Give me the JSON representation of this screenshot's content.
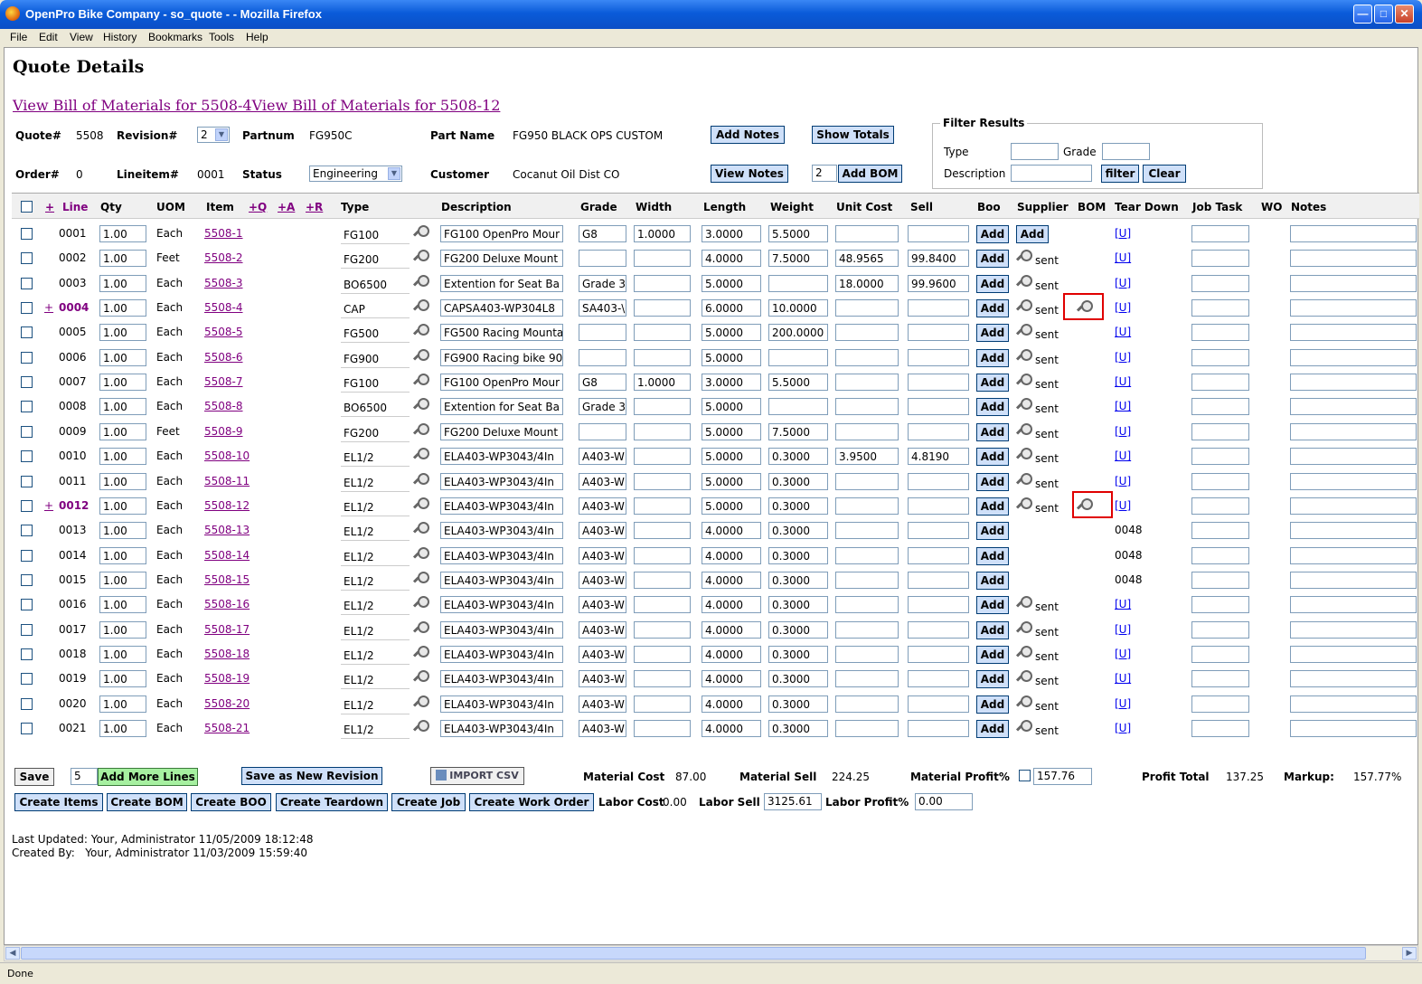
{
  "window": {
    "title": "OpenPro Bike Company - so_quote - - Mozilla Firefox"
  },
  "menu": [
    "File",
    "Edit",
    "View",
    "History",
    "Bookmarks",
    "Tools",
    "Help"
  ],
  "page": {
    "title": "Quote Details",
    "bom_links": "View Bill of Materials for 5508-4View Bill of Materials for 5508-12"
  },
  "header": {
    "quote_label": "Quote#",
    "quote": "5508",
    "revision_label": "Revision#",
    "revision": "2",
    "partnum_label": "Partnum",
    "partnum": "FG950C",
    "partname_label": "Part Name",
    "partname": "FG950 BLACK OPS CUSTOM",
    "order_label": "Order#",
    "order": "0",
    "lineitem_label": "Lineitem#",
    "lineitem": "0001",
    "status_label": "Status",
    "status": "Engineering",
    "customer_label": "Customer",
    "customer": "Cocanut Oil Dist CO",
    "add_notes": "Add Notes",
    "show_totals": "Show Totals",
    "view_notes": "View Notes",
    "bom_qty": "2",
    "add_bom": "Add BOM"
  },
  "filter": {
    "legend": "Filter Results",
    "type_label": "Type",
    "grade_label": "Grade",
    "description_label": "Description",
    "filter_btn": "filter",
    "clear_btn": "Clear"
  },
  "columns": {
    "plus": "+",
    "line": "Line",
    "qty": "Qty",
    "uom": "UOM",
    "item": "Item",
    "q": "+Q",
    "a": "+A",
    "r": "+R",
    "type": "Type",
    "description": "Description",
    "grade": "Grade",
    "width": "Width",
    "length": "Length",
    "weight": "Weight",
    "unit_cost": "Unit Cost",
    "sell": "Sell",
    "boo": "Boo",
    "supplier": "Supplier",
    "bom": "BOM",
    "tear_down": "Tear Down",
    "job_task": "Job Task",
    "wo": "WO",
    "notes": "Notes"
  },
  "rows": [
    {
      "plus": "",
      "line": "0001",
      "qty": "1.00",
      "uom": "Each",
      "item": "5508-1",
      "type": "FG100",
      "desc": "FG100 OpenPro Mour",
      "grade": "G8",
      "width": "1.0000",
      "length": "3.0000",
      "weight": "5.5000",
      "unit_cost": "",
      "sell": "",
      "supplier": "add",
      "bom": false,
      "tear": "[U]"
    },
    {
      "plus": "",
      "line": "0002",
      "qty": "1.00",
      "uom": "Feet",
      "item": "5508-2",
      "type": "FG200",
      "desc": "FG200 Deluxe Mount",
      "grade": "",
      "width": "",
      "length": "4.0000",
      "weight": "7.5000",
      "unit_cost": "48.9565",
      "sell": "99.8400",
      "supplier": "sent",
      "bom": false,
      "tear": "[U]"
    },
    {
      "plus": "",
      "line": "0003",
      "qty": "1.00",
      "uom": "Each",
      "item": "5508-3",
      "type": "BO6500",
      "desc": "Extention for Seat Ba",
      "grade": "Grade 3",
      "width": "",
      "length": "5.0000",
      "weight": "",
      "unit_cost": "18.0000",
      "sell": "99.9600",
      "supplier": "sent",
      "bom": false,
      "tear": "[U]"
    },
    {
      "plus": "+",
      "line": "0004",
      "qty": "1.00",
      "uom": "Each",
      "item": "5508-4",
      "type": "CAP",
      "desc": "CAPSA403-WP304L8",
      "grade": "SA403-\\",
      "width": "",
      "length": "6.0000",
      "weight": "10.0000",
      "unit_cost": "",
      "sell": "",
      "supplier": "sent",
      "bom": true,
      "tear": "[U]"
    },
    {
      "plus": "",
      "line": "0005",
      "qty": "1.00",
      "uom": "Each",
      "item": "5508-5",
      "type": "FG500",
      "desc": "FG500 Racing Mounta",
      "grade": "",
      "width": "",
      "length": "5.0000",
      "weight": "200.0000",
      "unit_cost": "",
      "sell": "",
      "supplier": "sent",
      "bom": false,
      "tear": "[U]"
    },
    {
      "plus": "",
      "line": "0006",
      "qty": "1.00",
      "uom": "Each",
      "item": "5508-6",
      "type": "FG900",
      "desc": "FG900 Racing bike 90",
      "grade": "",
      "width": "",
      "length": "5.0000",
      "weight": "",
      "unit_cost": "",
      "sell": "",
      "supplier": "sent",
      "bom": false,
      "tear": "[U]"
    },
    {
      "plus": "",
      "line": "0007",
      "qty": "1.00",
      "uom": "Each",
      "item": "5508-7",
      "type": "FG100",
      "desc": "FG100 OpenPro Mour",
      "grade": "G8",
      "width": "1.0000",
      "length": "3.0000",
      "weight": "5.5000",
      "unit_cost": "",
      "sell": "",
      "supplier": "sent",
      "bom": false,
      "tear": "[U]"
    },
    {
      "plus": "",
      "line": "0008",
      "qty": "1.00",
      "uom": "Each",
      "item": "5508-8",
      "type": "BO6500",
      "desc": "Extention for Seat Ba",
      "grade": "Grade 3",
      "width": "",
      "length": "5.0000",
      "weight": "",
      "unit_cost": "",
      "sell": "",
      "supplier": "sent",
      "bom": false,
      "tear": "[U]"
    },
    {
      "plus": "",
      "line": "0009",
      "qty": "1.00",
      "uom": "Feet",
      "item": "5508-9",
      "type": "FG200",
      "desc": "FG200 Deluxe Mount",
      "grade": "",
      "width": "",
      "length": "5.0000",
      "weight": "7.5000",
      "unit_cost": "",
      "sell": "",
      "supplier": "sent",
      "bom": false,
      "tear": "[U]"
    },
    {
      "plus": "",
      "line": "0010",
      "qty": "1.00",
      "uom": "Each",
      "item": "5508-10",
      "type": "EL1/2",
      "desc": "ELA403-WP3043/4In",
      "grade": "A403-W",
      "width": "",
      "length": "5.0000",
      "weight": "0.3000",
      "unit_cost": "3.9500",
      "sell": "4.8190",
      "supplier": "sent",
      "bom": false,
      "tear": "[U]"
    },
    {
      "plus": "",
      "line": "0011",
      "qty": "1.00",
      "uom": "Each",
      "item": "5508-11",
      "type": "EL1/2",
      "desc": "ELA403-WP3043/4In",
      "grade": "A403-W",
      "width": "",
      "length": "5.0000",
      "weight": "0.3000",
      "unit_cost": "",
      "sell": "",
      "supplier": "sent",
      "bom": false,
      "tear": "[U]"
    },
    {
      "plus": "+",
      "line": "0012",
      "qty": "1.00",
      "uom": "Each",
      "item": "5508-12",
      "type": "EL1/2",
      "desc": "ELA403-WP3043/4In",
      "grade": "A403-W",
      "width": "",
      "length": "5.0000",
      "weight": "0.3000",
      "unit_cost": "",
      "sell": "",
      "supplier": "sent",
      "bom": true,
      "tear": "[U]"
    },
    {
      "plus": "",
      "line": "0013",
      "qty": "1.00",
      "uom": "Each",
      "item": "5508-13",
      "type": "EL1/2",
      "desc": "ELA403-WP3043/4In",
      "grade": "A403-W",
      "width": "",
      "length": "4.0000",
      "weight": "0.3000",
      "unit_cost": "",
      "sell": "",
      "supplier": "none",
      "bom": false,
      "tear": "0048"
    },
    {
      "plus": "",
      "line": "0014",
      "qty": "1.00",
      "uom": "Each",
      "item": "5508-14",
      "type": "EL1/2",
      "desc": "ELA403-WP3043/4In",
      "grade": "A403-W",
      "width": "",
      "length": "4.0000",
      "weight": "0.3000",
      "unit_cost": "",
      "sell": "",
      "supplier": "none",
      "bom": false,
      "tear": "0048"
    },
    {
      "plus": "",
      "line": "0015",
      "qty": "1.00",
      "uom": "Each",
      "item": "5508-15",
      "type": "EL1/2",
      "desc": "ELA403-WP3043/4In",
      "grade": "A403-W",
      "width": "",
      "length": "4.0000",
      "weight": "0.3000",
      "unit_cost": "",
      "sell": "",
      "supplier": "none",
      "bom": false,
      "tear": "0048"
    },
    {
      "plus": "",
      "line": "0016",
      "qty": "1.00",
      "uom": "Each",
      "item": "5508-16",
      "type": "EL1/2",
      "desc": "ELA403-WP3043/4In",
      "grade": "A403-W",
      "width": "",
      "length": "4.0000",
      "weight": "0.3000",
      "unit_cost": "",
      "sell": "",
      "supplier": "sent",
      "bom": false,
      "tear": "[U]"
    },
    {
      "plus": "",
      "line": "0017",
      "qty": "1.00",
      "uom": "Each",
      "item": "5508-17",
      "type": "EL1/2",
      "desc": "ELA403-WP3043/4In",
      "grade": "A403-W",
      "width": "",
      "length": "4.0000",
      "weight": "0.3000",
      "unit_cost": "",
      "sell": "",
      "supplier": "sent",
      "bom": false,
      "tear": "[U]"
    },
    {
      "plus": "",
      "line": "0018",
      "qty": "1.00",
      "uom": "Each",
      "item": "5508-18",
      "type": "EL1/2",
      "desc": "ELA403-WP3043/4In",
      "grade": "A403-W",
      "width": "",
      "length": "4.0000",
      "weight": "0.3000",
      "unit_cost": "",
      "sell": "",
      "supplier": "sent",
      "bom": false,
      "tear": "[U]"
    },
    {
      "plus": "",
      "line": "0019",
      "qty": "1.00",
      "uom": "Each",
      "item": "5508-19",
      "type": "EL1/2",
      "desc": "ELA403-WP3043/4In",
      "grade": "A403-W",
      "width": "",
      "length": "4.0000",
      "weight": "0.3000",
      "unit_cost": "",
      "sell": "",
      "supplier": "sent",
      "bom": false,
      "tear": "[U]"
    },
    {
      "plus": "",
      "line": "0020",
      "qty": "1.00",
      "uom": "Each",
      "item": "5508-20",
      "type": "EL1/2",
      "desc": "ELA403-WP3043/4In",
      "grade": "A403-W",
      "width": "",
      "length": "4.0000",
      "weight": "0.3000",
      "unit_cost": "",
      "sell": "",
      "supplier": "sent",
      "bom": false,
      "tear": "[U]"
    },
    {
      "plus": "",
      "line": "0021",
      "qty": "1.00",
      "uom": "Each",
      "item": "5508-21",
      "type": "EL1/2",
      "desc": "ELA403-WP3043/4In",
      "grade": "A403-W",
      "width": "",
      "length": "4.0000",
      "weight": "0.3000",
      "unit_cost": "",
      "sell": "",
      "supplier": "sent",
      "bom": false,
      "tear": "[U]"
    }
  ],
  "row_labels": {
    "add": "Add",
    "sent": "sent"
  },
  "bottom": {
    "save": "Save",
    "more_lines_qty": "5",
    "add_more_lines": "Add More Lines",
    "save_new_revision": "Save as New Revision",
    "import_csv": "IMPORT CSV",
    "material_cost_label": "Material Cost",
    "material_cost": "87.00",
    "material_sell_label": "Material Sell",
    "material_sell": "224.25",
    "material_profit_label": "Material Profit%",
    "material_profit": "157.76",
    "profit_total_label": "Profit Total",
    "profit_total": "137.25",
    "markup_label": "Markup:",
    "markup": "157.77%",
    "create_items": "Create Items",
    "create_bom": "Create BOM",
    "create_boo": "Create BOO",
    "create_teardown": "Create Teardown",
    "create_job": "Create Job",
    "create_wo": "Create Work Order",
    "labor_cost_label": "Labor Cost",
    "labor_cost": "0.00",
    "labor_sell_label": "Labor Sell",
    "labor_sell": "3125.61",
    "labor_profit_label": "Labor Profit%",
    "labor_profit": "0.00"
  },
  "footer": {
    "last_updated": "Last Updated: Your, Administrator 11/05/2009 18:12:48",
    "created_by": "Created By:   Your, Administrator 11/03/2009 15:59:40"
  },
  "status_bar": "Done"
}
